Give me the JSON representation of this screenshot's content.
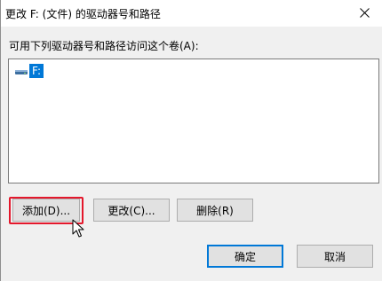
{
  "window": {
    "title": "更改 F: (文件) 的驱动器号和路径"
  },
  "main": {
    "instruction_label": "可用下列驱动器号和路径访问这个卷(A):",
    "list_items": [
      {
        "label": "F:",
        "icon": "drive-icon",
        "selected": true
      }
    ]
  },
  "actions": {
    "add_label": "添加(D)...",
    "change_label": "更改(C)...",
    "delete_label": "删除(R)"
  },
  "footer": {
    "ok_label": "确定",
    "cancel_label": "取消"
  },
  "colors": {
    "selection": "#0078d7",
    "highlight_outline": "#e4182c",
    "button_face": "#e1e1e1",
    "dialog_background": "#f0f0f0"
  }
}
